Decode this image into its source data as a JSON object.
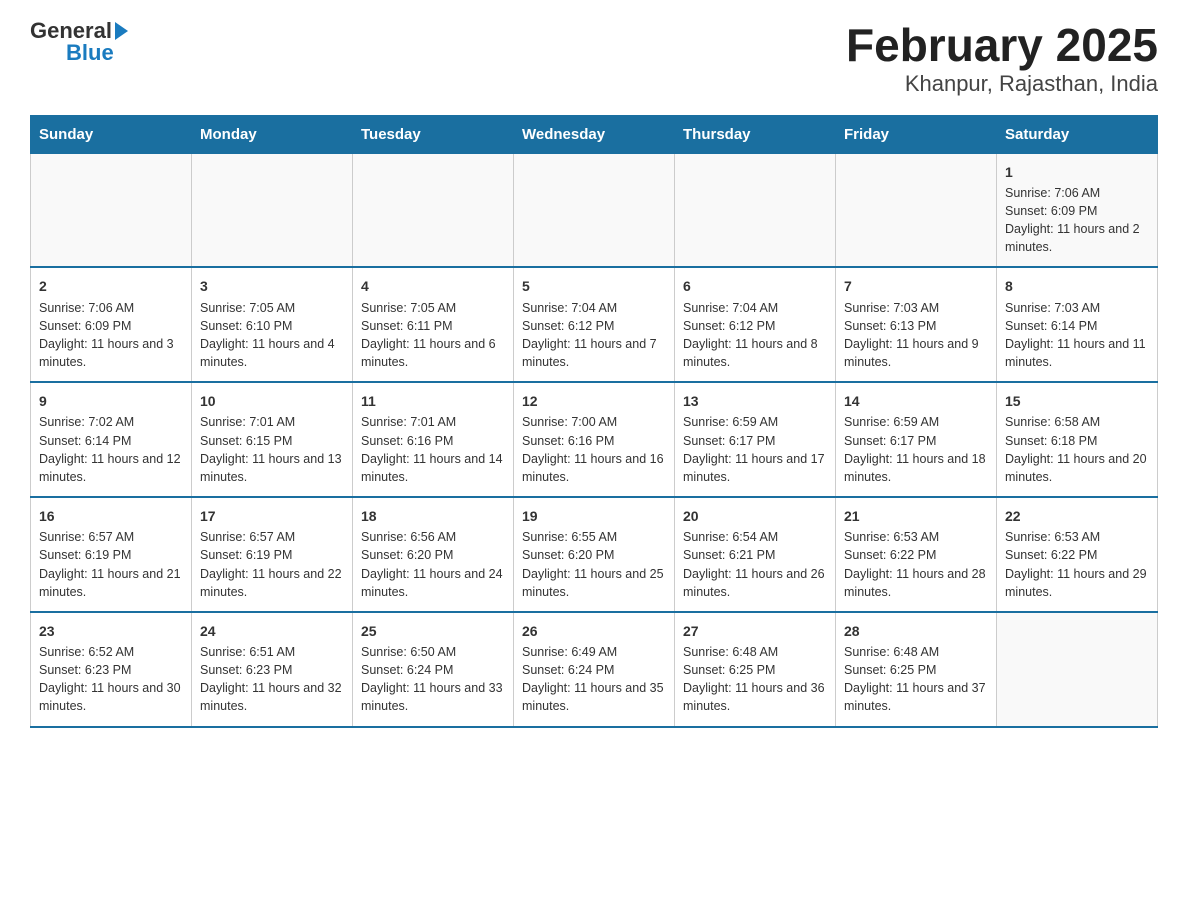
{
  "header": {
    "logo_general": "General",
    "logo_blue": "Blue",
    "title": "February 2025",
    "subtitle": "Khanpur, Rajasthan, India"
  },
  "days_of_week": [
    "Sunday",
    "Monday",
    "Tuesday",
    "Wednesday",
    "Thursday",
    "Friday",
    "Saturday"
  ],
  "weeks": [
    [
      {
        "day": "",
        "info": ""
      },
      {
        "day": "",
        "info": ""
      },
      {
        "day": "",
        "info": ""
      },
      {
        "day": "",
        "info": ""
      },
      {
        "day": "",
        "info": ""
      },
      {
        "day": "",
        "info": ""
      },
      {
        "day": "1",
        "info": "Sunrise: 7:06 AM\nSunset: 6:09 PM\nDaylight: 11 hours and 2 minutes."
      }
    ],
    [
      {
        "day": "2",
        "info": "Sunrise: 7:06 AM\nSunset: 6:09 PM\nDaylight: 11 hours and 3 minutes."
      },
      {
        "day": "3",
        "info": "Sunrise: 7:05 AM\nSunset: 6:10 PM\nDaylight: 11 hours and 4 minutes."
      },
      {
        "day": "4",
        "info": "Sunrise: 7:05 AM\nSunset: 6:11 PM\nDaylight: 11 hours and 6 minutes."
      },
      {
        "day": "5",
        "info": "Sunrise: 7:04 AM\nSunset: 6:12 PM\nDaylight: 11 hours and 7 minutes."
      },
      {
        "day": "6",
        "info": "Sunrise: 7:04 AM\nSunset: 6:12 PM\nDaylight: 11 hours and 8 minutes."
      },
      {
        "day": "7",
        "info": "Sunrise: 7:03 AM\nSunset: 6:13 PM\nDaylight: 11 hours and 9 minutes."
      },
      {
        "day": "8",
        "info": "Sunrise: 7:03 AM\nSunset: 6:14 PM\nDaylight: 11 hours and 11 minutes."
      }
    ],
    [
      {
        "day": "9",
        "info": "Sunrise: 7:02 AM\nSunset: 6:14 PM\nDaylight: 11 hours and 12 minutes."
      },
      {
        "day": "10",
        "info": "Sunrise: 7:01 AM\nSunset: 6:15 PM\nDaylight: 11 hours and 13 minutes."
      },
      {
        "day": "11",
        "info": "Sunrise: 7:01 AM\nSunset: 6:16 PM\nDaylight: 11 hours and 14 minutes."
      },
      {
        "day": "12",
        "info": "Sunrise: 7:00 AM\nSunset: 6:16 PM\nDaylight: 11 hours and 16 minutes."
      },
      {
        "day": "13",
        "info": "Sunrise: 6:59 AM\nSunset: 6:17 PM\nDaylight: 11 hours and 17 minutes."
      },
      {
        "day": "14",
        "info": "Sunrise: 6:59 AM\nSunset: 6:17 PM\nDaylight: 11 hours and 18 minutes."
      },
      {
        "day": "15",
        "info": "Sunrise: 6:58 AM\nSunset: 6:18 PM\nDaylight: 11 hours and 20 minutes."
      }
    ],
    [
      {
        "day": "16",
        "info": "Sunrise: 6:57 AM\nSunset: 6:19 PM\nDaylight: 11 hours and 21 minutes."
      },
      {
        "day": "17",
        "info": "Sunrise: 6:57 AM\nSunset: 6:19 PM\nDaylight: 11 hours and 22 minutes."
      },
      {
        "day": "18",
        "info": "Sunrise: 6:56 AM\nSunset: 6:20 PM\nDaylight: 11 hours and 24 minutes."
      },
      {
        "day": "19",
        "info": "Sunrise: 6:55 AM\nSunset: 6:20 PM\nDaylight: 11 hours and 25 minutes."
      },
      {
        "day": "20",
        "info": "Sunrise: 6:54 AM\nSunset: 6:21 PM\nDaylight: 11 hours and 26 minutes."
      },
      {
        "day": "21",
        "info": "Sunrise: 6:53 AM\nSunset: 6:22 PM\nDaylight: 11 hours and 28 minutes."
      },
      {
        "day": "22",
        "info": "Sunrise: 6:53 AM\nSunset: 6:22 PM\nDaylight: 11 hours and 29 minutes."
      }
    ],
    [
      {
        "day": "23",
        "info": "Sunrise: 6:52 AM\nSunset: 6:23 PM\nDaylight: 11 hours and 30 minutes."
      },
      {
        "day": "24",
        "info": "Sunrise: 6:51 AM\nSunset: 6:23 PM\nDaylight: 11 hours and 32 minutes."
      },
      {
        "day": "25",
        "info": "Sunrise: 6:50 AM\nSunset: 6:24 PM\nDaylight: 11 hours and 33 minutes."
      },
      {
        "day": "26",
        "info": "Sunrise: 6:49 AM\nSunset: 6:24 PM\nDaylight: 11 hours and 35 minutes."
      },
      {
        "day": "27",
        "info": "Sunrise: 6:48 AM\nSunset: 6:25 PM\nDaylight: 11 hours and 36 minutes."
      },
      {
        "day": "28",
        "info": "Sunrise: 6:48 AM\nSunset: 6:25 PM\nDaylight: 11 hours and 37 minutes."
      },
      {
        "day": "",
        "info": ""
      }
    ]
  ],
  "accent_color": "#1a6fa0"
}
